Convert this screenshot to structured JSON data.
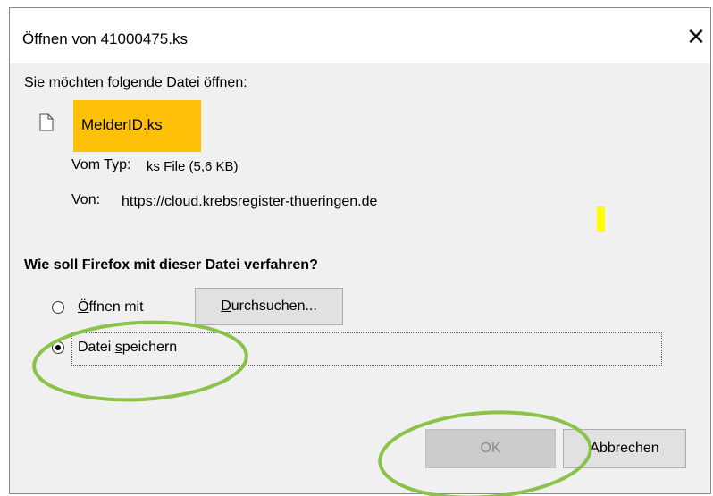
{
  "dialog": {
    "title": "Öffnen von 41000475.ks",
    "close_glyph": "✕"
  },
  "file_info": {
    "prompt": "Sie möchten folgende Datei öffnen:",
    "filename": "MelderID.ks",
    "type_label": "Vom Typ:",
    "type_value": "ks File (5,6 KB)",
    "from_label": "Von:",
    "from_value": "https://cloud.krebsregister-thueringen.de",
    "icon": "file-icon"
  },
  "action": {
    "question": "Wie soll Firefox mit dieser Datei verfahren?",
    "open_with": {
      "accel": "Ö",
      "rest": "ffnen mit",
      "selected": false
    },
    "browse": {
      "accel": "D",
      "rest": "urchsuchen..."
    },
    "save": {
      "pre": "Datei ",
      "accel": "s",
      "rest": "peichern",
      "selected": true
    }
  },
  "buttons": {
    "ok": "OK",
    "cancel": "Abbrechen"
  },
  "colors": {
    "highlight": "#ffc107",
    "annotation_circle": "#8bc34a",
    "yellow_mark": "#ffff00"
  }
}
